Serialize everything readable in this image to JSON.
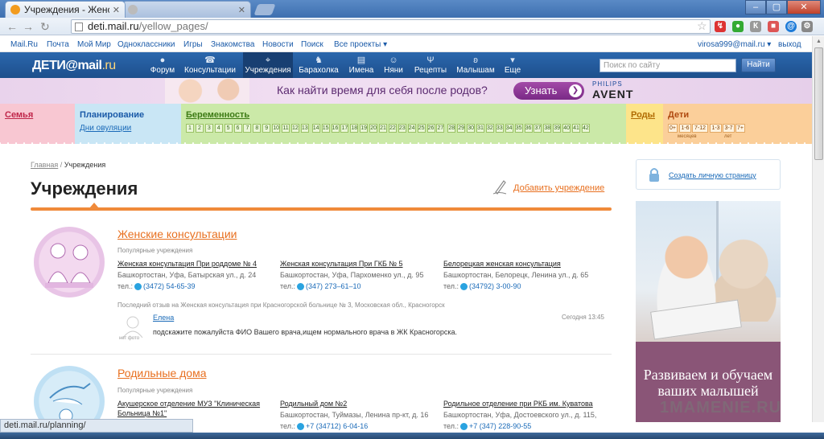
{
  "browser": {
    "tabs": [
      {
        "title": "Учреждения - Женск"
      },
      {
        "title": ""
      }
    ],
    "url_host": "deti.mail.ru",
    "url_path": "/yellow_pages/"
  },
  "mailbar": {
    "links": [
      "Mail.Ru",
      "Почта",
      "Мой Мир",
      "Одноклассники",
      "Игры",
      "Знакомства",
      "Новости",
      "Поиск",
      "Все проекты ▾"
    ],
    "user": "virosa999@mail.ru ▾",
    "logout": "выход"
  },
  "header": {
    "logo_main": "ДЕТИ@mail",
    "logo_suffix": ".ru",
    "nav": [
      "Форум",
      "Консультации",
      "Учреждения",
      "Барахолка",
      "Имена",
      "Няни",
      "Рецепты",
      "Малышам",
      "Еще"
    ],
    "search_placeholder": "Поиск по сайту",
    "search_button": "Найти"
  },
  "banner": {
    "text": "Как найти время для себя после родов?",
    "button": "Узнать",
    "brand_top": "PHILIPS",
    "brand_bottom": "AVENT"
  },
  "categories": {
    "family": "Семья",
    "planning": "Планирование",
    "ovulation": "Дни овуляции",
    "pregnancy": "Беременность",
    "weeks": [
      "1",
      "2",
      "3",
      "4",
      "5",
      "6",
      "7",
      "8",
      "9",
      "10",
      "11",
      "12",
      "13",
      "14",
      "15",
      "16",
      "17",
      "18",
      "19",
      "20",
      "21",
      "22",
      "23",
      "24",
      "25",
      "26",
      "27",
      "28",
      "29",
      "30",
      "31",
      "32",
      "33",
      "34",
      "35",
      "36",
      "37",
      "38",
      "39",
      "40",
      "41",
      "42"
    ],
    "birth": "Роды",
    "kids": "Дети",
    "ages": [
      "0+",
      "1-6",
      "7-12",
      "1-3",
      "3-7",
      "7+"
    ],
    "age_months": "месяцев",
    "age_years": "лет"
  },
  "breadcrumb": {
    "home": "Главная",
    "sep": "/",
    "current": "Учреждения"
  },
  "page": {
    "title": "Учреждения",
    "add_link": "Добавить учреждение"
  },
  "sections": [
    {
      "title": "Женские консультации",
      "popular": "Популярные учреждения",
      "items": [
        {
          "name": "Женская консультация При роддоме № 4",
          "address": "Башкортостан, Уфа, Батырская ул., д. 24",
          "tel_label": "тел.:",
          "phone": "(3472) 54-65-39"
        },
        {
          "name": "Женская консультация При ГКБ № 5",
          "address": "Башкортостан, Уфа, Пархоменко ул., д. 95",
          "tel_label": "тел.:",
          "phone": "(347) 273–61–10"
        },
        {
          "name": "Белорецкая женская консультация",
          "address": "Башкортостан, Белорецк, Ленина ул., д. 65",
          "tel_label": "тел.:",
          "phone": "(34792) 3-00-90"
        }
      ],
      "last_review": "Последний отзыв на Женская консультация при Красногорской больнице № 3, Московская обл., Красногорск",
      "review": {
        "author": "Елена",
        "time": "Сегодня 13:45",
        "text": "подскажите пожалуйста ФИО Вашего врача,ищем нормального врача в ЖК Красногорска.",
        "no_photo": "нет фото"
      }
    },
    {
      "title": "Родильные дома",
      "popular": "Популярные учреждения",
      "items": [
        {
          "name": "Акушерское отделение МУЗ \"Клиническая Больница №1\"",
          "address": "",
          "tel_label": "",
          "phone": ""
        },
        {
          "name": "Родильный дом №2",
          "address": "Башкортостан, Туймазы, Ленина пр-кт, д. 16",
          "tel_label": "тел.:",
          "phone": "+7 (34712) 6-04-16"
        },
        {
          "name": "Родильное отделение при РКБ им. Куватова",
          "address": "Башкортостан, Уфа, Достоевского ул., д. 115,",
          "tel_label": "тел.:",
          "phone": "+7 (347) 228-90-55"
        }
      ]
    }
  ],
  "sidebar": {
    "create_page": "Создать личную страницу",
    "ad_text": "Развиваем и обучаем ваших малышей"
  },
  "watermark": "1MAMENIE.RU",
  "status_url": "deti.mail.ru/planning/",
  "colors": {
    "orange": "#e87020",
    "header_blue": "#2b67ad",
    "link_blue": "#1a6ab8"
  }
}
